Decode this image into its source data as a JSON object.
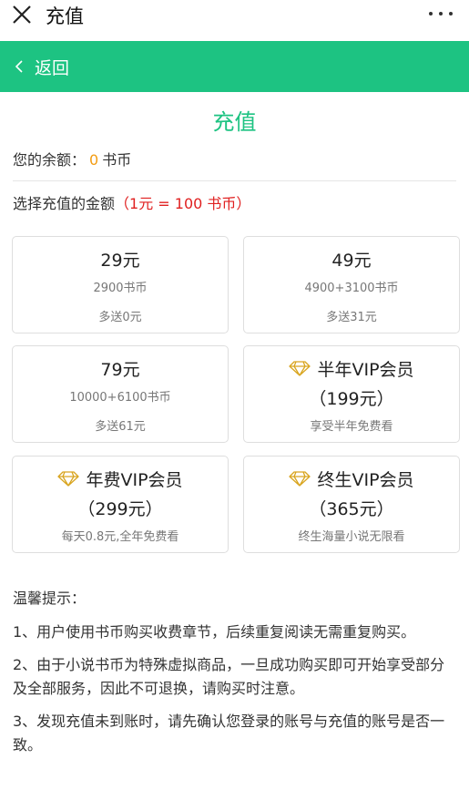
{
  "topbar": {
    "title": "充值"
  },
  "navbar": {
    "back_label": "返回"
  },
  "page": {
    "title": "充值"
  },
  "balance": {
    "label": "您的余额：",
    "value": "0",
    "unit": "书币"
  },
  "choose": {
    "label": "选择充值的金额",
    "rate": "（1元 = 100 书币）"
  },
  "plans": [
    {
      "price": "29元",
      "coins": "2900书币",
      "bonus": "多送0元"
    },
    {
      "price": "49元",
      "coins": "4900+3100书币",
      "bonus": "多送31元"
    },
    {
      "price": "79元",
      "coins": "10000+6100书币",
      "bonus": "多送61元"
    }
  ],
  "vip": [
    {
      "title": "半年VIP会员",
      "price": "（199元）",
      "desc": "享受半年免费看"
    },
    {
      "title": "年费VIP会员",
      "price": "（299元）",
      "desc": "每天0.8元,全年免费看"
    },
    {
      "title": "终生VIP会员",
      "price": "（365元）",
      "desc": "终生海量小说无限看"
    }
  ],
  "tips": {
    "heading": "温馨提示：",
    "items": [
      "1、用户使用书币购买收费章节，后续重复阅读无需重复购买。",
      "2、由于小说书币为特殊虚拟商品，一旦成功购买即可开始享受部分及全部服务，因此不可退换，请购买时注意。",
      "3、发现充值未到账时，请先确认您登录的账号与充值的账号是否一致。"
    ]
  },
  "colors": {
    "accent": "#1dc382",
    "balance": "#f39c12",
    "rate": "#e02020",
    "diamond": "#d9a520"
  },
  "icons": {
    "close": "close-icon",
    "more": "more-icon",
    "back": "chevron-left-icon",
    "vip": "diamond-icon"
  }
}
